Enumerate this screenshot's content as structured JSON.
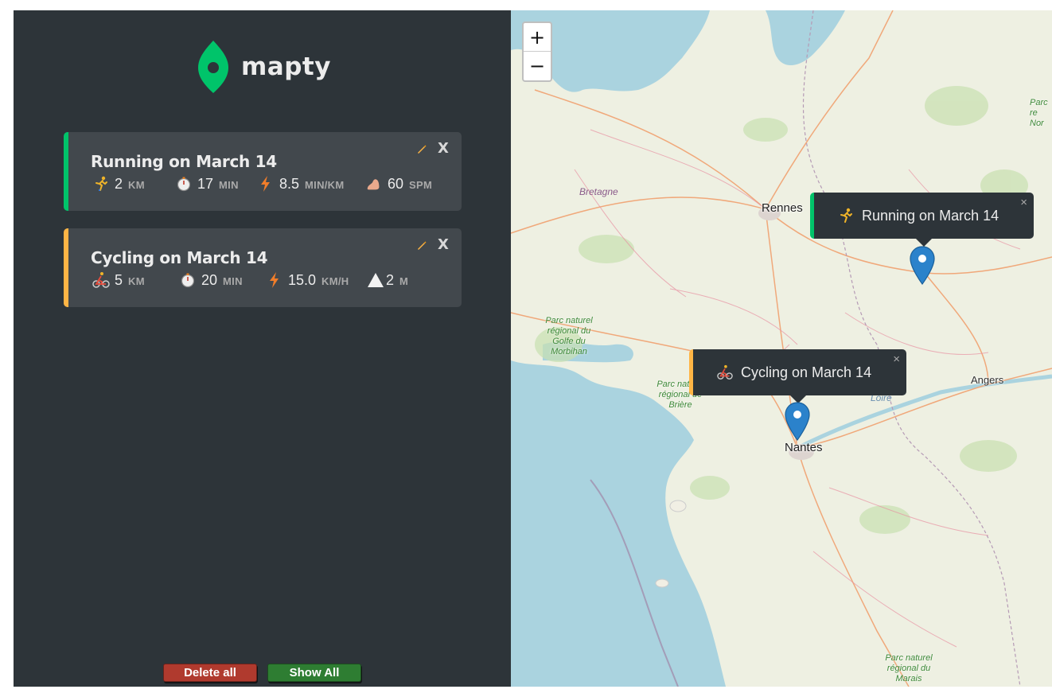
{
  "app": {
    "name": "mapty"
  },
  "workouts": [
    {
      "type": "running",
      "title": "Running on March 14",
      "type_icon": "running-person-icon",
      "distance": {
        "value": "2",
        "unit": "km"
      },
      "duration": {
        "value": "17",
        "unit": "min"
      },
      "speed": {
        "value": "8.5",
        "unit": "min/km"
      },
      "extra": {
        "value": "60",
        "unit": "spm",
        "icon": "footprint-icon"
      }
    },
    {
      "type": "cycling",
      "title": "Cycling on March 14",
      "type_icon": "cyclist-icon",
      "distance": {
        "value": "5",
        "unit": "km"
      },
      "duration": {
        "value": "20",
        "unit": "min"
      },
      "speed": {
        "value": "15.0",
        "unit": "km/h"
      },
      "extra": {
        "value": "2",
        "unit": "m",
        "icon": "mountain-icon"
      }
    }
  ],
  "actions": {
    "close_label": "X",
    "delete_all": "Delete all",
    "show_all": "Show All"
  },
  "map": {
    "zoom_in": "+",
    "zoom_out": "−",
    "popup_close": "×",
    "popups": [
      "Running on March 14",
      "Cycling on March 14"
    ],
    "places": {
      "rennes": "Rennes",
      "nantes": "Nantes",
      "angers": "Angers",
      "bretagne": "Bretagne",
      "loire": "Loire",
      "park_golfe": "Parc naturel régional du Golfe du Morbihan",
      "park_briere": "Parc naturel régional de Brière",
      "park_marais": "Parc naturel régional du Marais",
      "park_normandie": "Parc re Nor"
    }
  },
  "colors": {
    "running": "#00c46a",
    "cycling": "#ffb545",
    "sidebar": "#2d3439",
    "card": "#42484d"
  }
}
